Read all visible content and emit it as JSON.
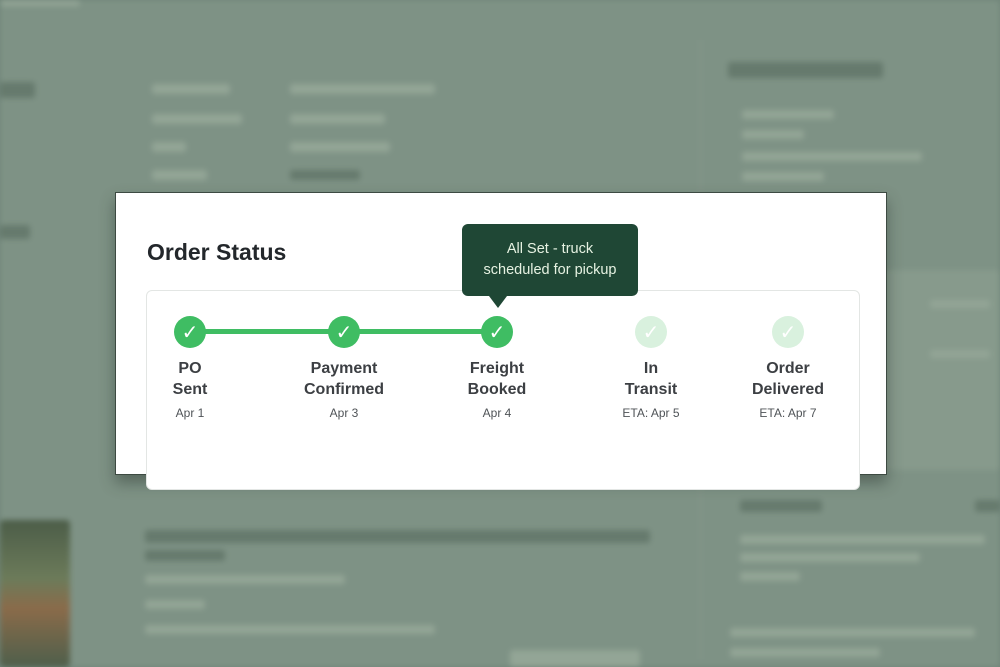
{
  "order_status": {
    "title": "Order Status",
    "tooltip": {
      "line1": "All Set - truck",
      "line2": "scheduled for pickup"
    },
    "steps": [
      {
        "line1": "PO",
        "line2": "Sent",
        "date": "Apr 1",
        "state": "done",
        "icon": "check-icon"
      },
      {
        "line1": "Payment",
        "line2": "Confirmed",
        "date": "Apr 3",
        "state": "done",
        "icon": "check-icon"
      },
      {
        "line1": "Freight",
        "line2": "Booked",
        "date": "Apr 4",
        "state": "done",
        "icon": "check-icon"
      },
      {
        "line1": "In",
        "line2": "Transit",
        "date": "ETA: Apr 5",
        "state": "pending",
        "icon": "check-icon"
      },
      {
        "line1": "Order",
        "line2": "Delivered",
        "date": "ETA: Apr 7",
        "state": "pending",
        "icon": "check-icon"
      }
    ],
    "colors": {
      "complete": "#3fbd63",
      "pending": "#d9f1de",
      "tooltip_bg": "#1f4735",
      "tooltip_text": "#e6f2e2"
    }
  }
}
